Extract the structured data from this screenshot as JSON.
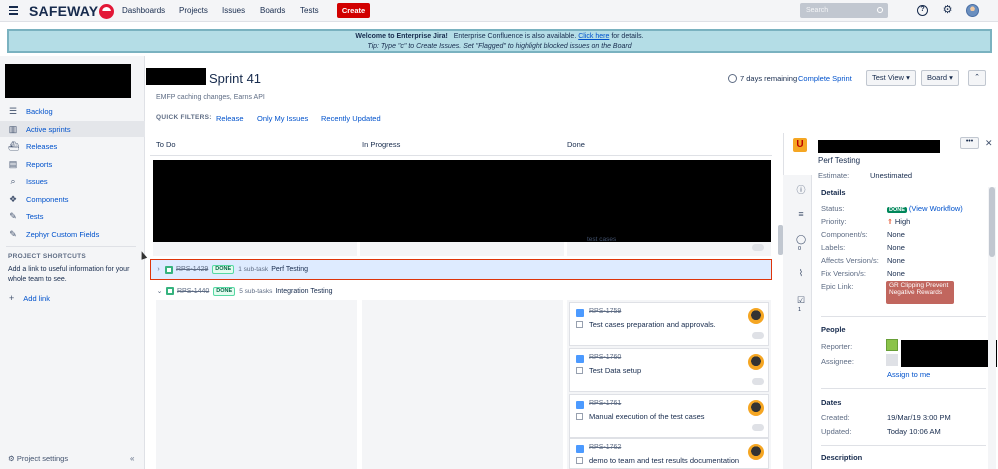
{
  "topnav": {
    "logo_text": "SAFEWAY",
    "items": [
      "Dashboards",
      "Projects",
      "Issues",
      "Boards",
      "Tests"
    ],
    "create_label": "Create",
    "search_placeholder": "Search"
  },
  "banner": {
    "title": "Welcome to Enterprise Jira!",
    "confluence_text": "Enterprise Confluence is also available.",
    "link_text": "Click here",
    "link_suffix": "for details.",
    "tip": "Tip: Type \"c\" to Create Issues.  Set \"Flagged\" to highlight blocked issues on the Board"
  },
  "sidebar": {
    "items": [
      {
        "label": "Backlog",
        "icon": "backlog-icon"
      },
      {
        "label": "Active sprints",
        "icon": "active-sprints-icon"
      },
      {
        "label": "Releases",
        "icon": "releases-icon"
      },
      {
        "label": "Reports",
        "icon": "reports-icon"
      },
      {
        "label": "Issues",
        "icon": "issues-icon"
      },
      {
        "label": "Components",
        "icon": "components-icon"
      },
      {
        "label": "Tests",
        "icon": "tests-icon"
      },
      {
        "label": "Zephyr Custom Fields",
        "icon": "zephyr-icon"
      }
    ],
    "shortcuts_title": "PROJECT SHORTCUTS",
    "shortcuts_text": "Add a link to useful information for your whole team to see.",
    "add_link": "Add link",
    "project_settings": "Project settings"
  },
  "board": {
    "sprint_title": "Sprint 41",
    "sprint_subtitle": "EMFP caching changes, Earns API",
    "quick_filters_label": "QUICK FILTERS:",
    "quick_filters": [
      "Release",
      "Only My Issues",
      "Recently Updated"
    ],
    "days_remaining": "7 days remaining",
    "complete_sprint": "Complete Sprint",
    "view_button": "Test View",
    "board_button": "Board",
    "columns": [
      "To Do",
      "In Progress",
      "Done"
    ],
    "ghost_card_text": "test cases",
    "swimlanes": [
      {
        "key": "RPS-1429",
        "status": "DONE",
        "subtasks": "1 sub-task",
        "summary": "Perf Testing",
        "expanded": false,
        "selected": true
      },
      {
        "key": "RPS-1440",
        "status": "DONE",
        "subtasks": "5 sub-tasks",
        "summary": "Integration Testing",
        "expanded": true,
        "selected": false
      }
    ],
    "cards": [
      {
        "key": "RPS-1759",
        "summary": "Test cases preparation and approvals."
      },
      {
        "key": "RPS-1760",
        "summary": "Test Data setup"
      },
      {
        "key": "RPS-1761",
        "summary": "Manual execution of the test cases"
      },
      {
        "key": "RPS-1762",
        "summary": "demo to team and test results documentation"
      }
    ]
  },
  "detail": {
    "summary": "Perf Testing",
    "estimate_label": "Estimate:",
    "estimate_value": "Unestimated",
    "details_title": "Details",
    "fields": {
      "status_label": "Status:",
      "status_value": "DONE",
      "view_workflow": "(View Workflow)",
      "priority_label": "Priority:",
      "priority_value": "High",
      "components_label": "Component/s:",
      "components_value": "None",
      "labels_label": "Labels:",
      "labels_value": "None",
      "affects_label": "Affects Version/s:",
      "affects_value": "None",
      "fix_label": "Fix Version/s:",
      "fix_value": "None",
      "epic_label": "Epic Link:",
      "epic_value": "GR Clipping Prevent Negative Rewards"
    },
    "people_title": "People",
    "reporter_label": "Reporter:",
    "assignee_label": "Assignee:",
    "assign_to_me": "Assign to me",
    "dates_title": "Dates",
    "created_label": "Created:",
    "created_value": "19/Mar/19 3:00 PM",
    "updated_label": "Updated:",
    "updated_value": "Today 10:06 AM",
    "description_title": "Description",
    "comments_count": "0",
    "subtasks_count": "1"
  },
  "colors": {
    "accent": "#0052cc",
    "create": "#d10000",
    "banner_bg": "#b4dde6",
    "epic": "#c1665e",
    "done": "#00875a"
  }
}
